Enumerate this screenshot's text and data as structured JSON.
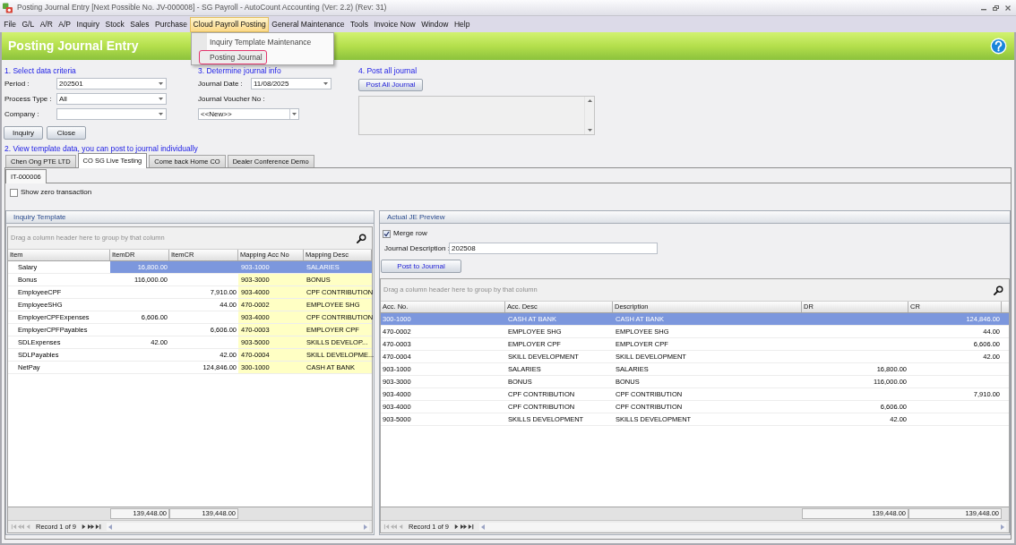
{
  "window": {
    "title": "Posting Journal Entry [Next Possible No. JV-000008] - SG Payroll - AutoCount Accounting (Ver: 2.2) (Rev: 31)"
  },
  "menu_bar": [
    {
      "label": "File",
      "selected": false
    },
    {
      "label": "G/L",
      "selected": false
    },
    {
      "label": "A/R",
      "selected": false
    },
    {
      "label": "A/P",
      "selected": false
    },
    {
      "label": "Inquiry",
      "selected": false
    },
    {
      "label": "Stock",
      "selected": false
    },
    {
      "label": "Sales",
      "selected": false
    },
    {
      "label": "Purchase",
      "selected": false
    },
    {
      "label": "Cloud Payroll Posting",
      "selected": true
    },
    {
      "label": "General Maintenance",
      "selected": false
    },
    {
      "label": "Tools",
      "selected": false
    },
    {
      "label": "Invoice Now",
      "selected": false
    },
    {
      "label": "Window",
      "selected": false
    },
    {
      "label": "Help",
      "selected": false
    }
  ],
  "open_menu": {
    "items": [
      {
        "label": "Inquiry Template Maintenance",
        "selected": false
      },
      {
        "label": "Posting Journal",
        "selected": true
      }
    ]
  },
  "header": {
    "title": "Posting Journal Entry"
  },
  "criteria": {
    "heading": "1. Select data criteria",
    "fields": [
      {
        "label": "Period :",
        "value": "202501"
      },
      {
        "label": "Process Type :",
        "value": "All"
      },
      {
        "label": "Company :"
      }
    ],
    "buttons": [
      "Inquiry",
      "Close"
    ]
  },
  "journal_info": {
    "heading": "3. Determine journal info",
    "date_label": "Journal Date :",
    "date": "11/08/2025",
    "voucher_label": "Journal Voucher No :",
    "voucher": "<<New>>"
  },
  "post_all": {
    "heading": "4. Post all journal",
    "button": "Post All Journal"
  },
  "template_heading": "2. View template data, you can post to journal individually",
  "company_tabs": [
    {
      "label": "Chen Ong PTE LTD",
      "selected": false
    },
    {
      "label": "CO SG Live Testing",
      "selected": true
    },
    {
      "label": "Come back Home CO",
      "selected": false
    },
    {
      "label": "Dealer Conference Demo",
      "selected": false
    }
  ],
  "template_tabs": [
    {
      "label": "IT-000006",
      "selected": true
    }
  ],
  "show_zero": {
    "label": "Show zero transaction",
    "checked": false
  },
  "inquiry_template": {
    "title": "Inquiry Template",
    "group_hint": "Drag a column header here to group by that column",
    "columns": [
      "Item",
      "ItemDR",
      "ItemCR",
      "Mapping Acc No",
      "Mapping Desc"
    ],
    "rows": [
      {
        "item": "Salary",
        "item_dr": "16,800.00",
        "mapping_acc_no": "903-1000",
        "mapping_desc": "SALARIES",
        "selected": true
      },
      {
        "item": "Bonus",
        "item_dr": "116,000.00",
        "mapping_acc_no": "903-3000",
        "mapping_desc": "BONUS",
        "selected": false
      },
      {
        "item": "EmployeeCPF",
        "item_cr": "7,910.00",
        "mapping_acc_no": "903-4000",
        "mapping_desc": "CPF CONTRIBUTION",
        "selected": false
      },
      {
        "item": "EmployeeSHG",
        "item_cr": "44.00",
        "mapping_acc_no": "470-0002",
        "mapping_desc": "EMPLOYEE SHG",
        "selected": false
      },
      {
        "item": "EmployerCPFExpenses",
        "item_dr": "6,606.00",
        "mapping_acc_no": "903-4000",
        "mapping_desc": "CPF CONTRIBUTION",
        "selected": false
      },
      {
        "item": "EmployerCPFPayables",
        "item_cr": "6,606.00",
        "mapping_acc_no": "470-0003",
        "mapping_desc": "EMPLOYER CPF",
        "selected": false
      },
      {
        "item": "SDLExpenses",
        "item_dr": "42.00",
        "mapping_acc_no": "903-5000",
        "mapping_desc": "SKILLS DEVELOP...",
        "selected": false
      },
      {
        "item": "SDLPayables",
        "item_cr": "42.00",
        "mapping_acc_no": "470-0004",
        "mapping_desc": "SKILL DEVELOPME...",
        "selected": false
      },
      {
        "item": "NetPay",
        "item_cr": "124,846.00",
        "mapping_acc_no": "300-1000",
        "mapping_desc": "CASH AT BANK",
        "selected": false
      }
    ],
    "totals": {
      "item_dr": "139,448.00",
      "item_cr": "139,448.00"
    },
    "navigator": {
      "record": "Record 1 of 9",
      "back_enabled": false,
      "forward_enabled": true
    }
  },
  "je_preview": {
    "title": "Actual JE Preview",
    "merge_row": {
      "label": "Merge row",
      "checked": true
    },
    "description_label": "Journal Description :",
    "description": "202508",
    "button": "Post to Journal",
    "group_hint": "Drag a column header here to group by that column",
    "columns": [
      "Acc. No.",
      "Acc. Desc",
      "Description",
      "DR",
      "CR"
    ],
    "rows": [
      {
        "acc_no": "300-1000",
        "acc_desc": "CASH AT BANK",
        "description": "CASH AT BANK",
        "cr": "124,846.00",
        "selected": true
      },
      {
        "acc_no": "470-0002",
        "acc_desc": "EMPLOYEE SHG",
        "description": "EMPLOYEE SHG",
        "cr": "44.00",
        "selected": false
      },
      {
        "acc_no": "470-0003",
        "acc_desc": "EMPLOYER CPF",
        "description": "EMPLOYER CPF",
        "cr": "6,606.00",
        "selected": false
      },
      {
        "acc_no": "470-0004",
        "acc_desc": "SKILL DEVELOPMENT",
        "description": "SKILL DEVELOPMENT",
        "cr": "42.00",
        "selected": false
      },
      {
        "acc_no": "903-1000",
        "acc_desc": "SALARIES",
        "description": "SALARIES",
        "dr": "16,800.00",
        "selected": false
      },
      {
        "acc_no": "903-3000",
        "acc_desc": "BONUS",
        "description": "BONUS",
        "dr": "116,000.00",
        "selected": false
      },
      {
        "acc_no": "903-4000",
        "acc_desc": "CPF CONTRIBUTION",
        "description": "CPF CONTRIBUTION",
        "cr": "7,910.00",
        "selected": false
      },
      {
        "acc_no": "903-4000",
        "acc_desc": "CPF CONTRIBUTION",
        "description": "CPF CONTRIBUTION",
        "dr": "6,606.00",
        "selected": false
      },
      {
        "acc_no": "903-5000",
        "acc_desc": "SKILLS DEVELOPMENT",
        "description": "SKILLS DEVELOPMENT",
        "dr": "42.00",
        "selected": false
      }
    ],
    "totals": {
      "dr": "139,448.00",
      "cr": "139,448.00"
    },
    "navigator": {
      "record": "Record 1 of 9",
      "back_enabled": false,
      "forward_enabled": true
    }
  }
}
